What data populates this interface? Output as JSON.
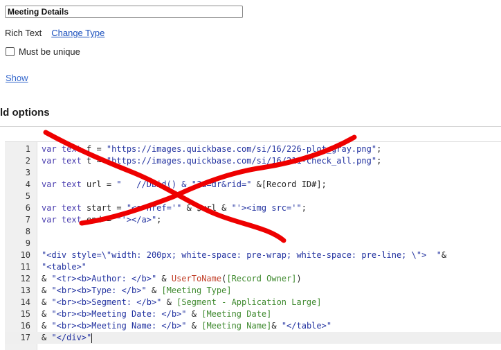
{
  "field": {
    "name_value": "Meeting Details",
    "type_label": "Rich Text",
    "change_type_link": "Change Type",
    "unique_label": "Must be unique",
    "unique_checked": false,
    "show_link": "Show"
  },
  "section": {
    "heading": "ld options"
  },
  "editor": {
    "active_line": 17,
    "lines": [
      {
        "num": "1",
        "tokens": [
          [
            "kw",
            "var text"
          ],
          [
            "plain",
            " f = "
          ],
          [
            "str",
            "\"https://images.quickbase.com/si/16/226-plot_gray.png\""
          ],
          [
            "plain",
            ";"
          ]
        ]
      },
      {
        "num": "2",
        "tokens": [
          [
            "kw",
            "var text"
          ],
          [
            "plain",
            " t = "
          ],
          [
            "str",
            "\"https://images.quickbase.com/si/16/211-check_all.png\""
          ],
          [
            "plain",
            ";"
          ]
        ]
      },
      {
        "num": "3",
        "tokens": []
      },
      {
        "num": "4",
        "tokens": [
          [
            "kw",
            "var text"
          ],
          [
            "plain",
            " url = "
          ],
          [
            "str",
            "\"   //Dbid() & \"?a=dr&rid=\""
          ],
          [
            "plain",
            " &[Record ID#];"
          ]
        ]
      },
      {
        "num": "5",
        "tokens": []
      },
      {
        "num": "6",
        "tokens": [
          [
            "kw",
            "var text"
          ],
          [
            "plain",
            " start = "
          ],
          [
            "str",
            "\"<a href='\""
          ],
          [
            "plain",
            " & $url & "
          ],
          [
            "str",
            "\"'><img src='\""
          ],
          [
            "plain",
            ";"
          ]
        ]
      },
      {
        "num": "7",
        "tokens": [
          [
            "kw",
            "var text"
          ],
          [
            "plain",
            " end = "
          ],
          [
            "str",
            "\"'></a>\""
          ],
          [
            "plain",
            ";"
          ]
        ]
      },
      {
        "num": "8",
        "tokens": []
      },
      {
        "num": "9",
        "tokens": []
      },
      {
        "num": "10",
        "tokens": [
          [
            "str",
            "\"<div style=\\\"width: 200px; white-space: pre-wrap; white-space: pre-line; \\\">  \""
          ],
          [
            "plain",
            "&"
          ]
        ]
      },
      {
        "num": "11",
        "tokens": [
          [
            "str",
            "\"<table>\""
          ]
        ]
      },
      {
        "num": "12",
        "tokens": [
          [
            "plain",
            "& "
          ],
          [
            "str",
            "\"<tr><b>Author: </b>\""
          ],
          [
            "plain",
            " & "
          ],
          [
            "fn",
            "UserToName"
          ],
          [
            "plain",
            "("
          ],
          [
            "fld",
            "[Record Owner]"
          ],
          [
            "plain",
            ")"
          ]
        ]
      },
      {
        "num": "13",
        "tokens": [
          [
            "plain",
            "& "
          ],
          [
            "str",
            "\"<br><b>Type: </b>\""
          ],
          [
            "plain",
            " & "
          ],
          [
            "fld",
            "[Meeting Type]"
          ]
        ]
      },
      {
        "num": "14",
        "tokens": [
          [
            "plain",
            "& "
          ],
          [
            "str",
            "\"<br><b>Segment: </b>\""
          ],
          [
            "plain",
            " & "
          ],
          [
            "fld",
            "[Segment - Application Large]"
          ]
        ]
      },
      {
        "num": "15",
        "tokens": [
          [
            "plain",
            "& "
          ],
          [
            "str",
            "\"<br><b>Meeting Date: </b>\""
          ],
          [
            "plain",
            " & "
          ],
          [
            "fld",
            "[Meeting Date]"
          ]
        ]
      },
      {
        "num": "16",
        "tokens": [
          [
            "plain",
            "& "
          ],
          [
            "str",
            "\"<br><b>Meeting Name: </b>\""
          ],
          [
            "plain",
            " & "
          ],
          [
            "fld",
            "[Meeting Name]"
          ],
          [
            "plain",
            "& "
          ],
          [
            "str",
            "\"</table>\""
          ]
        ]
      },
      {
        "num": "17",
        "tokens": [
          [
            "plain",
            "& "
          ],
          [
            "str",
            "\"</div>\""
          ]
        ]
      }
    ]
  },
  "annotation": {
    "stroke_color": "#ee0000"
  }
}
